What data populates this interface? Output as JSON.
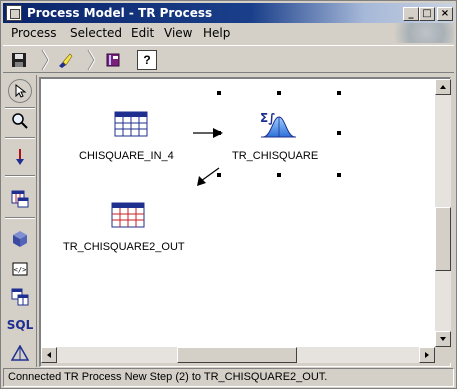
{
  "window": {
    "title": "Process Model - TR Process",
    "controls": {
      "minimize": "_",
      "maximize": "□",
      "close": "×"
    }
  },
  "menubar": {
    "items": [
      {
        "label": "Process"
      },
      {
        "label": "Selected"
      },
      {
        "label": "Edit"
      },
      {
        "label": "View"
      },
      {
        "label": "Help"
      }
    ]
  },
  "toolbar": {
    "buttons": [
      "save-icon",
      "highlighter-icon",
      "book-icon",
      "help-icon"
    ],
    "help_label": "?"
  },
  "palette": {
    "tools": [
      "select-arrow-icon",
      "zoom-icon",
      "connect-arrow-icon",
      "table-link-icon",
      "cube-icon",
      "script-icon",
      "tables-icon",
      "sql-icon",
      "triangle-icon"
    ],
    "sql_label": "SQL"
  },
  "canvas": {
    "nodes": [
      {
        "label": "CHISQUARE_IN_4",
        "icon": "table-icon"
      },
      {
        "label": "TR_CHISQUARE",
        "icon": "chisquare-distribution-icon",
        "symbols": "Σ∫"
      },
      {
        "label": "TR_CHISQUARE2_OUT",
        "icon": "table-icon"
      }
    ]
  },
  "colors": {
    "title_active": "#0a246a",
    "face": "#d4d0c8",
    "table_header": "#1f2f8f",
    "table_grid": "#c81f1f"
  },
  "status": {
    "text": "Connected TR Process New Step (2) to TR_CHISQUARE2_OUT."
  }
}
